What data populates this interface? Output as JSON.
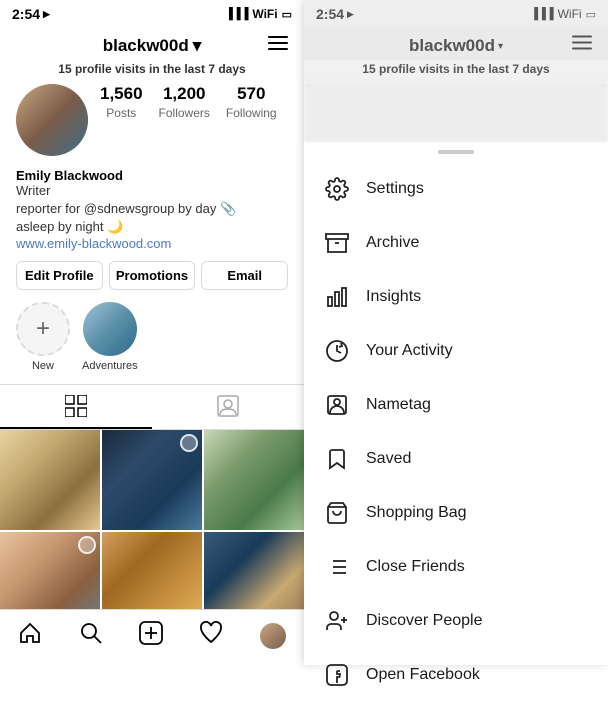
{
  "left": {
    "statusBar": {
      "time": "2:54",
      "timeArrow": "▶"
    },
    "header": {
      "username": "blackw00d",
      "chevron": "▾",
      "hamburger": "☰"
    },
    "visitCount": {
      "number": "15",
      "text": " profile visits in the last 7 days"
    },
    "stats": {
      "posts": {
        "number": "1,560",
        "label": "Posts"
      },
      "followers": {
        "number": "1,200",
        "label": "Followers"
      },
      "following": {
        "number": "570",
        "label": "Following"
      }
    },
    "bio": {
      "name": "Emily Blackwood",
      "role": "Writer",
      "text": "reporter for @sdnewsgroup by day 📎\nasleep by night 🌙",
      "link": "www.emily-blackwood.com"
    },
    "buttons": {
      "editProfile": "Edit Profile",
      "promotions": "Promotions",
      "email": "Email"
    },
    "highlights": [
      {
        "label": "New",
        "type": "add"
      },
      {
        "label": "Adventures",
        "type": "img"
      }
    ],
    "bottomNav": {
      "home": "⌂",
      "search": "🔍",
      "add": "⊕",
      "heart": "♡"
    }
  },
  "right": {
    "statusBar": {
      "time": "2:54",
      "timeArrow": "▶"
    },
    "header": {
      "username": "blackw00d",
      "chevron": "▾",
      "hamburger": "☰"
    },
    "visitCount": {
      "number": "15",
      "text": " profile visits in the last 7 days"
    },
    "menuItems": [
      {
        "id": "settings",
        "label": "Settings"
      },
      {
        "id": "archive",
        "label": "Archive"
      },
      {
        "id": "insights",
        "label": "Insights"
      },
      {
        "id": "your-activity",
        "label": "Your Activity"
      },
      {
        "id": "nametag",
        "label": "Nametag"
      },
      {
        "id": "saved",
        "label": "Saved"
      },
      {
        "id": "shopping-bag",
        "label": "Shopping Bag"
      },
      {
        "id": "close-friends",
        "label": "Close Friends"
      },
      {
        "id": "discover-people",
        "label": "Discover People"
      },
      {
        "id": "open-facebook",
        "label": "Open Facebook"
      }
    ]
  }
}
